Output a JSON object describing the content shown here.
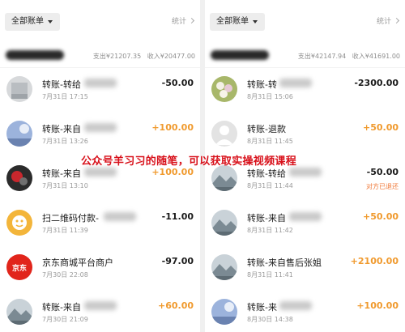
{
  "colors": {
    "income": "#f09a2e",
    "expense": "#1a1a1a",
    "watermark": "#d8101a",
    "status": "#f07a3a"
  },
  "watermark": "公众号羊习习的随笔，可以获取实操视频课程",
  "left": {
    "filter_label": "全部账单",
    "stats_label": "统计",
    "summary": {
      "expense": "支出¥21207.35",
      "income": "收入¥20477.00"
    },
    "transactions": [
      {
        "title": "转账-转给",
        "time": "7月31日 17:15",
        "amount": "-50.00",
        "income": false,
        "avatar": "gray-square"
      },
      {
        "title": "转账-来自",
        "time": "7月31日 13:26",
        "amount": "+100.00",
        "income": true,
        "avatar": "sky"
      },
      {
        "title": "转账-来自",
        "time": "7月31日 13:10",
        "amount": "+100.00",
        "income": true,
        "avatar": "dark"
      },
      {
        "title": "扫二维码付款-",
        "time": "7月31日 11:39",
        "amount": "-11.00",
        "income": false,
        "avatar": "emoji-icon"
      },
      {
        "title": "京东商城平台商户",
        "time": "7月30日 22:08",
        "amount": "-97.00",
        "income": false,
        "avatar": "jd-logo",
        "avatar_text": "京东"
      },
      {
        "title": "转账-来自",
        "time": "7月30日 21:09",
        "amount": "+60.00",
        "income": true,
        "avatar": "mountain"
      }
    ]
  },
  "right": {
    "filter_label": "全部账单",
    "stats_label": "统计",
    "summary": {
      "expense": "支出¥42147.94",
      "income": "收入¥41691.00"
    },
    "transactions": [
      {
        "title": "转账-转",
        "time": "8月31日 15:06",
        "amount": "-2300.00",
        "income": false,
        "avatar": "flowers"
      },
      {
        "title": "转账-退款",
        "time": "8月31日 11:45",
        "amount": "+50.00",
        "income": true,
        "avatar": "default-person-icon"
      },
      {
        "title": "转账-转给",
        "time": "8月31日 11:44",
        "amount": "-50.00",
        "income": false,
        "avatar": "mountain",
        "status": "对方已退还"
      },
      {
        "title": "转账-来自",
        "time": "8月31日 11:42",
        "amount": "+50.00",
        "income": true,
        "avatar": "mountain"
      },
      {
        "title": "转账-来自售后张姐",
        "time": "8月31日 11:41",
        "amount": "+2100.00",
        "income": true,
        "avatar": "mountain"
      },
      {
        "title": "转账-来",
        "time": "8月30日 14:38",
        "amount": "+100.00",
        "income": true,
        "avatar": "sky"
      }
    ]
  }
}
